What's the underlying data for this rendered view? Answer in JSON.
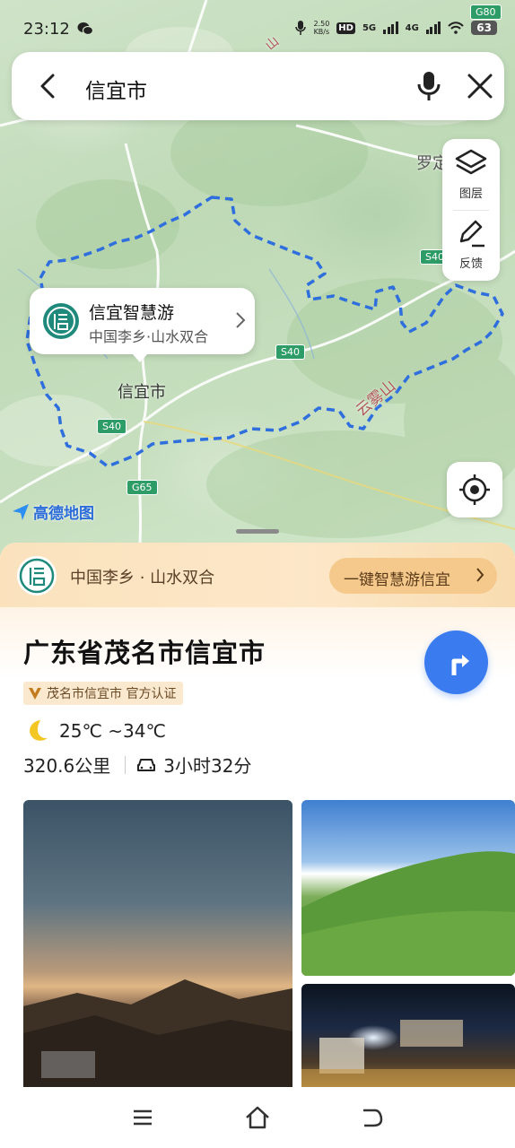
{
  "status_bar": {
    "time": "23:12",
    "net_speed_value": "2.50",
    "net_speed_unit": "KB/s",
    "hd": "HD",
    "g5": "5G",
    "g4": "4G",
    "battery": "63"
  },
  "search": {
    "query": "信宜市"
  },
  "tools": {
    "layers_label": "图层",
    "feedback_label": "反馈"
  },
  "map": {
    "city_label": "信宜市",
    "luo_label": "罗定",
    "mountain_label": "云雾山",
    "shan_label": "山",
    "roads": {
      "s40_a": "S40",
      "s40_b": "S40",
      "s40_c": "S40",
      "g65": "G65",
      "g80": "G80"
    },
    "brand": "高德地图",
    "poi": {
      "title": "信宜智慧游",
      "subtitle": "中国李乡·山水双合"
    }
  },
  "sheet": {
    "banner_text": "中国李乡 · 山水双合",
    "banner_button": "一键智慧游信宜",
    "title": "广东省茂名市信宜市",
    "badge": "茂名市信宜市 官方认证",
    "weather": "25℃ ~34℃",
    "distance": "320.6公里",
    "drive_time": "3小时32分"
  },
  "colors": {
    "accent": "#3a7bf0",
    "boundary": "#2f6fdd",
    "banner": "#fce7c8"
  }
}
